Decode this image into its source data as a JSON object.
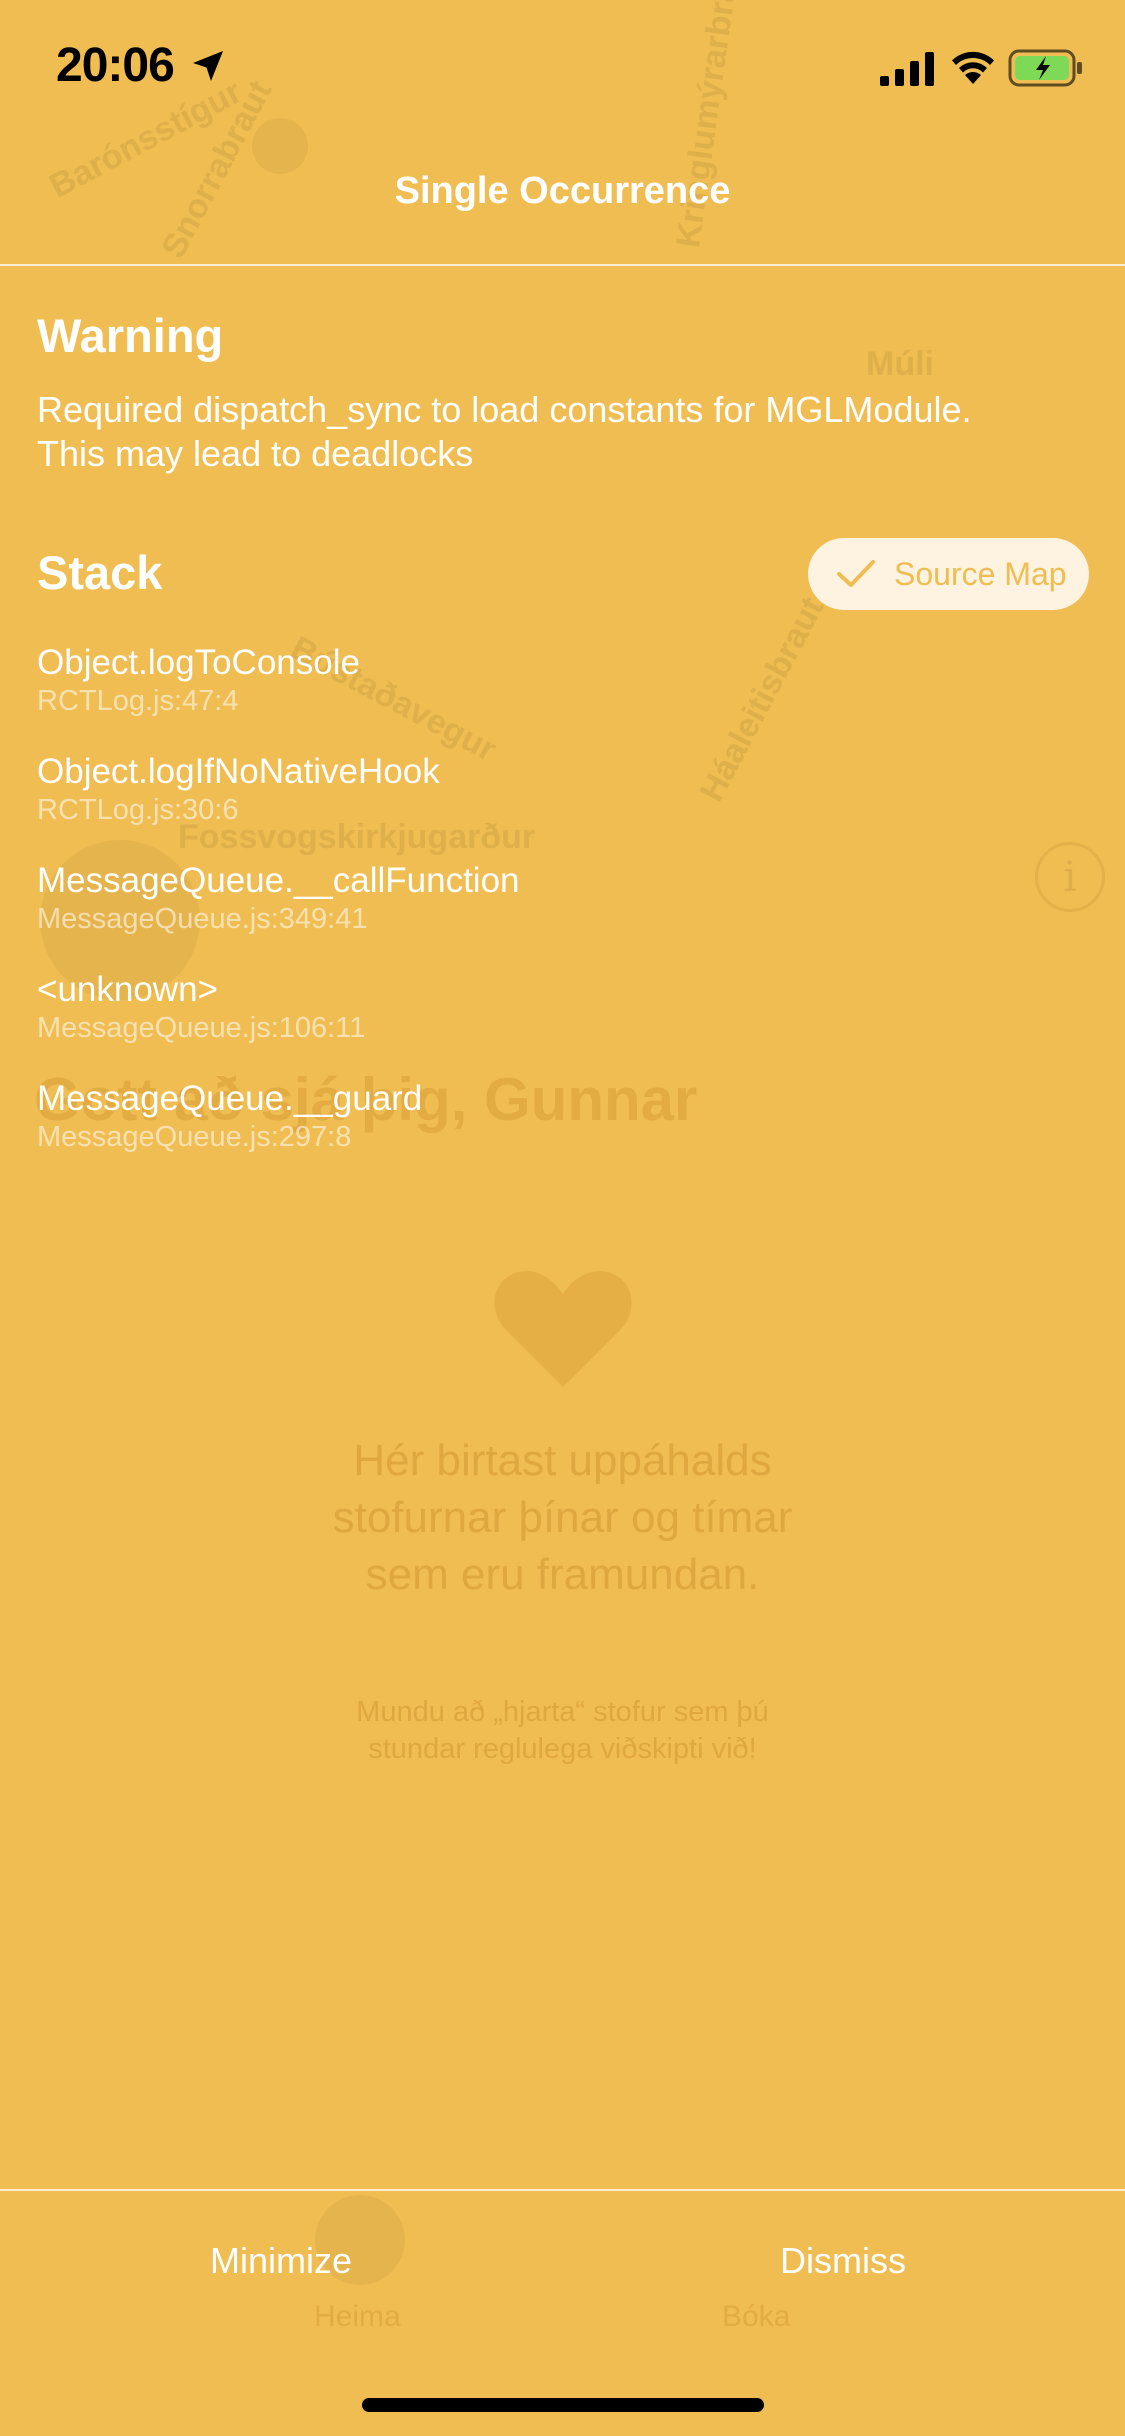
{
  "status_bar": {
    "time": "20:06"
  },
  "overlay": {
    "title": "Single Occurrence",
    "warning": {
      "heading": "Warning",
      "message_line1": "Required dispatch_sync to load constants for MGLModule.",
      "message_line2": "This may lead to deadlocks"
    },
    "stack": {
      "heading": "Stack",
      "source_map_label": "Source Map",
      "frames": [
        {
          "method": "Object.logToConsole",
          "location": "RCTLog.js:47:4"
        },
        {
          "method": "Object.logIfNoNativeHook",
          "location": "RCTLog.js:30:6"
        },
        {
          "method": "MessageQueue.__callFunction",
          "location": "MessageQueue.js:349:41"
        },
        {
          "method": "<unknown>",
          "location": "MessageQueue.js:106:11"
        },
        {
          "method": "MessageQueue.__guard",
          "location": "MessageQueue.js:297:8"
        }
      ]
    },
    "footer": {
      "minimize_label": "Minimize",
      "dismiss_label": "Dismiss"
    }
  },
  "background": {
    "map_labels": [
      "Barónsstígur",
      "Snorrabraut",
      "Kringlumýrarbraut",
      "Bústaðavegur",
      "Háaleitisbraut",
      "Fossvogskirkjugarður",
      "Múli"
    ],
    "greeting": "Gott að sjá þig, Gunnar",
    "empty_line1": "Hér birtast uppáhalds",
    "empty_line2": "stofurnar þínar og tímar",
    "empty_line3": "sem eru framundan.",
    "hint_line1": "Mundu að „hjarta“ stofur sem þú",
    "hint_line2": "stundar reglulega viðskipti við!",
    "tab_home": "Heima",
    "tab_other": "Bóka"
  },
  "colors": {
    "overlay_background": "#f0bd52",
    "text_primary": "#ffffff",
    "battery_fill": "#7ed957"
  }
}
